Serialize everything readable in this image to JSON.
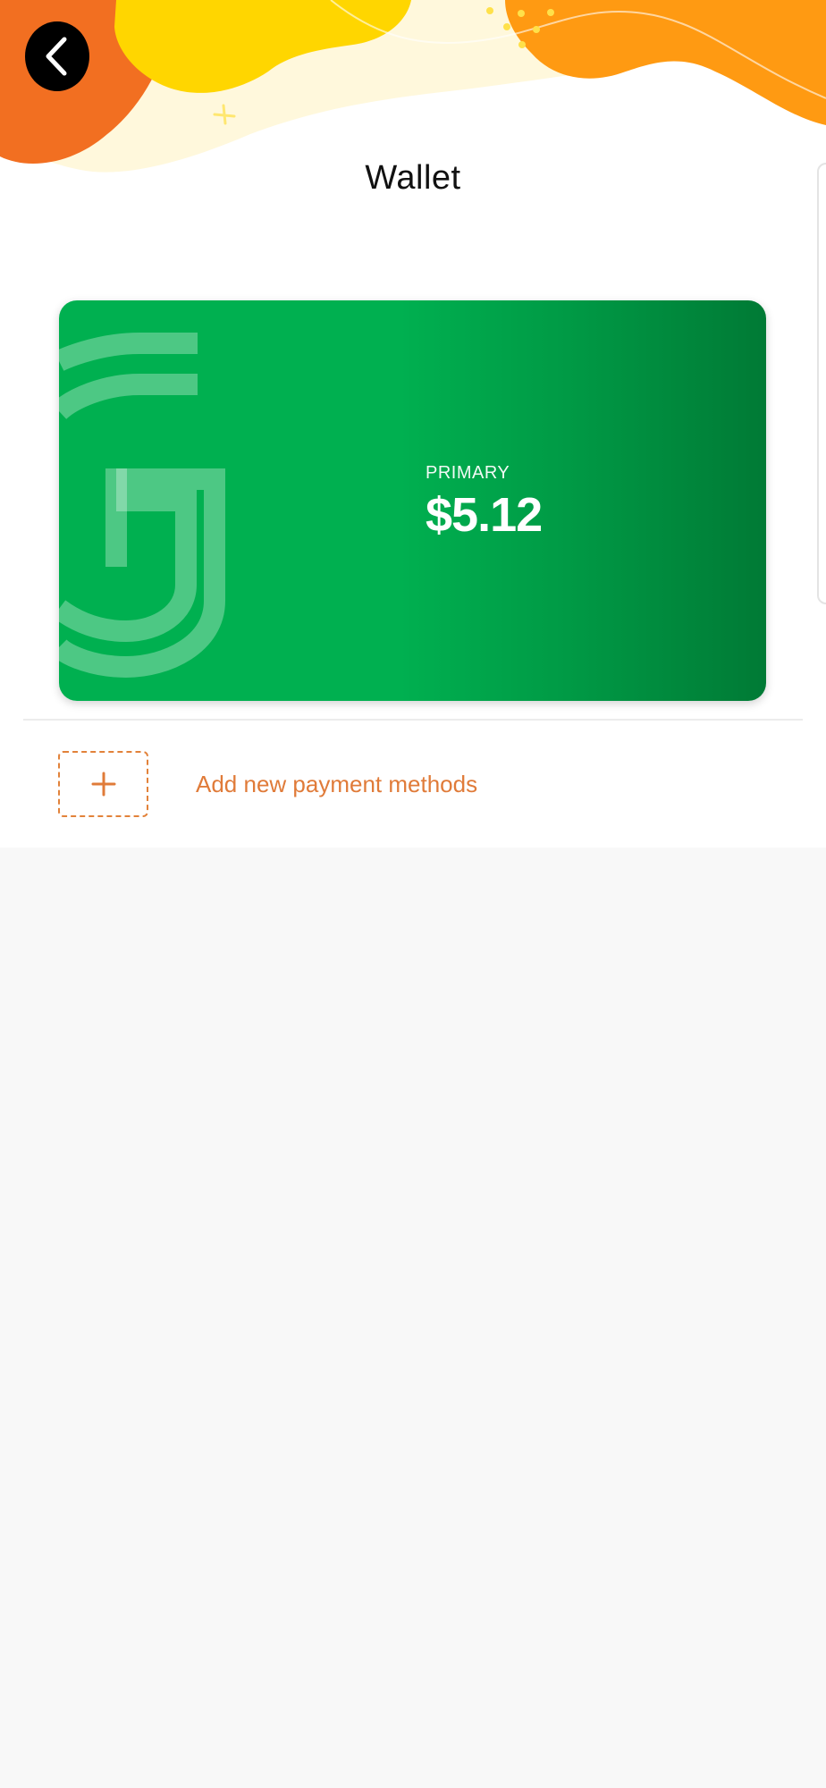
{
  "header": {
    "title": "Wallet",
    "back_icon": "chevron-left-icon"
  },
  "card": {
    "label": "PRIMARY",
    "balance": "$5.12",
    "logo": "g-logo-watermark",
    "colors": {
      "start": "#00b050",
      "end": "#007a35"
    }
  },
  "add_payment": {
    "label": "Add new payment methods",
    "icon": "plus-icon",
    "color": "#e07b39"
  },
  "colors": {
    "accent_orange": "#f26f21",
    "accent_yellow": "#ffd600",
    "background": "#f8f8f8"
  }
}
